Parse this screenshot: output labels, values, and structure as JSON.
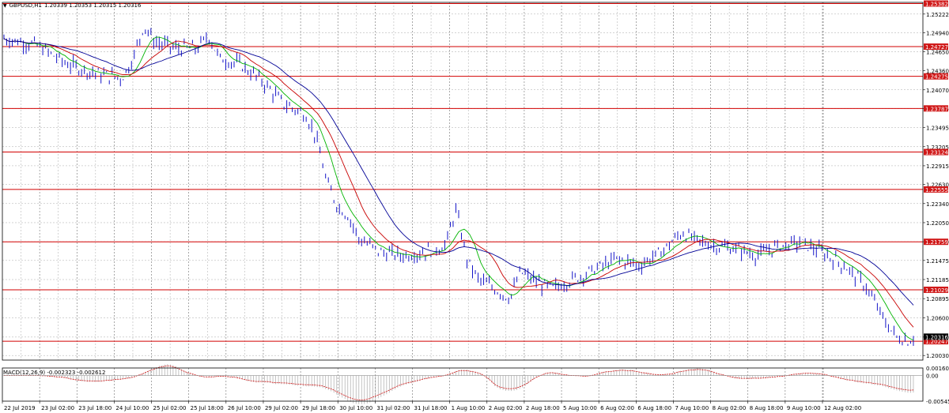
{
  "header": {
    "symbol": "GBPUSD,H1",
    "ohlc": "1.20339 1.20353 1.20315 1.20316",
    "menu_glyph": "▼"
  },
  "macd_header": "MACD(12,26,9) -0.002323 -0.002612",
  "colors": {
    "grid": "#a8a8a8",
    "border": "#000000",
    "candle": "#1414c8",
    "ma_fast": "#00b400",
    "ma_mid": "#c80000",
    "ma_slow": "#000096",
    "level": "#d20000",
    "label_bg": "#d01818",
    "label_fg": "#ffffff",
    "macd_hist": "#b4b4b4",
    "macd_signal": "#d21414"
  },
  "price_axis": {
    "ticks": [
      "1.25222",
      "1.24940",
      "1.24650",
      "1.24360",
      "1.24070",
      "1.23785",
      "1.23495",
      "1.23205",
      "1.22915",
      "1.22630",
      "1.22340",
      "1.22050",
      "1.21760",
      "1.21475",
      "1.21185",
      "1.20895",
      "1.20600",
      "1.20310",
      "1.20030"
    ],
    "current": "1.20316"
  },
  "levels": [
    {
      "label": "1.25382",
      "price": 1.25382
    },
    {
      "label": "1.24727",
      "price": 1.24727
    },
    {
      "label": "1.24275",
      "price": 1.24275
    },
    {
      "label": "1.23787",
      "price": 1.23787
    },
    {
      "label": "1.23124",
      "price": 1.23124
    },
    {
      "label": "1.22555",
      "price": 1.22555
    },
    {
      "label": "1.21759",
      "price": 1.21759
    },
    {
      "label": "1.21029",
      "price": 1.21029
    },
    {
      "label": "1.20247",
      "price": 1.20247
    }
  ],
  "macd_axis": [
    "0.001606",
    "0.00",
    "-0.005458"
  ],
  "time_axis": [
    "22 Jul 2019",
    "23 Jul 02:00",
    "23 Jul 18:00",
    "24 Jul 10:00",
    "25 Jul 02:00",
    "25 Jul 18:00",
    "26 Jul 10:00",
    "29 Jul 02:00",
    "29 Jul 18:00",
    "30 Jul 10:00",
    "31 Jul 02:00",
    "31 Jul 18:00",
    "1 Aug 10:00",
    "2 Aug 02:00",
    "2 Aug 18:00",
    "5 Aug 10:00",
    "6 Aug 02:00",
    "6 Aug 18:00",
    "7 Aug 10:00",
    "8 Aug 02:00",
    "8 Aug 18:00",
    "9 Aug 10:00",
    "12 Aug 02:00"
  ],
  "price_path": [
    [
      0,
      1.2485
    ],
    [
      0.03,
      1.2475
    ],
    [
      0.06,
      1.2445
    ],
    [
      0.09,
      1.243
    ],
    [
      0.11,
      1.2425
    ],
    [
      0.12,
      1.2455
    ],
    [
      0.13,
      1.2505
    ],
    [
      0.14,
      1.248
    ],
    [
      0.16,
      1.247
    ],
    [
      0.18,
      1.247
    ],
    [
      0.19,
      1.249
    ],
    [
      0.2,
      1.2455
    ],
    [
      0.22,
      1.2445
    ],
    [
      0.24,
      1.242
    ],
    [
      0.26,
      1.2385
    ],
    [
      0.28,
      1.237
    ],
    [
      0.29,
      1.2335
    ],
    [
      0.3,
      1.2265
    ],
    [
      0.31,
      1.223
    ],
    [
      0.32,
      1.2215
    ],
    [
      0.33,
      1.218
    ],
    [
      0.35,
      1.216
    ],
    [
      0.37,
      1.2155
    ],
    [
      0.39,
      1.216
    ],
    [
      0.41,
      1.217
    ],
    [
      0.42,
      1.2225
    ],
    [
      0.43,
      1.215
    ],
    [
      0.44,
      1.212
    ],
    [
      0.46,
      1.21
    ],
    [
      0.47,
      1.209
    ],
    [
      0.48,
      1.213
    ],
    [
      0.5,
      1.211
    ],
    [
      0.51,
      1.2105
    ],
    [
      0.53,
      1.212
    ],
    [
      0.55,
      1.2135
    ],
    [
      0.57,
      1.215
    ],
    [
      0.59,
      1.214
    ],
    [
      0.61,
      1.216
    ],
    [
      0.63,
      1.219
    ],
    [
      0.64,
      1.218
    ],
    [
      0.66,
      1.217
    ],
    [
      0.68,
      1.2165
    ],
    [
      0.7,
      1.2155
    ],
    [
      0.72,
      1.217
    ],
    [
      0.74,
      1.2175
    ],
    [
      0.76,
      1.216
    ],
    [
      0.78,
      1.214
    ],
    [
      0.8,
      1.211
    ],
    [
      0.81,
      1.208
    ],
    [
      0.82,
      1.205
    ],
    [
      0.83,
      1.203
    ],
    [
      0.84,
      1.2025
    ],
    [
      0.85,
      1.2032
    ]
  ]
}
